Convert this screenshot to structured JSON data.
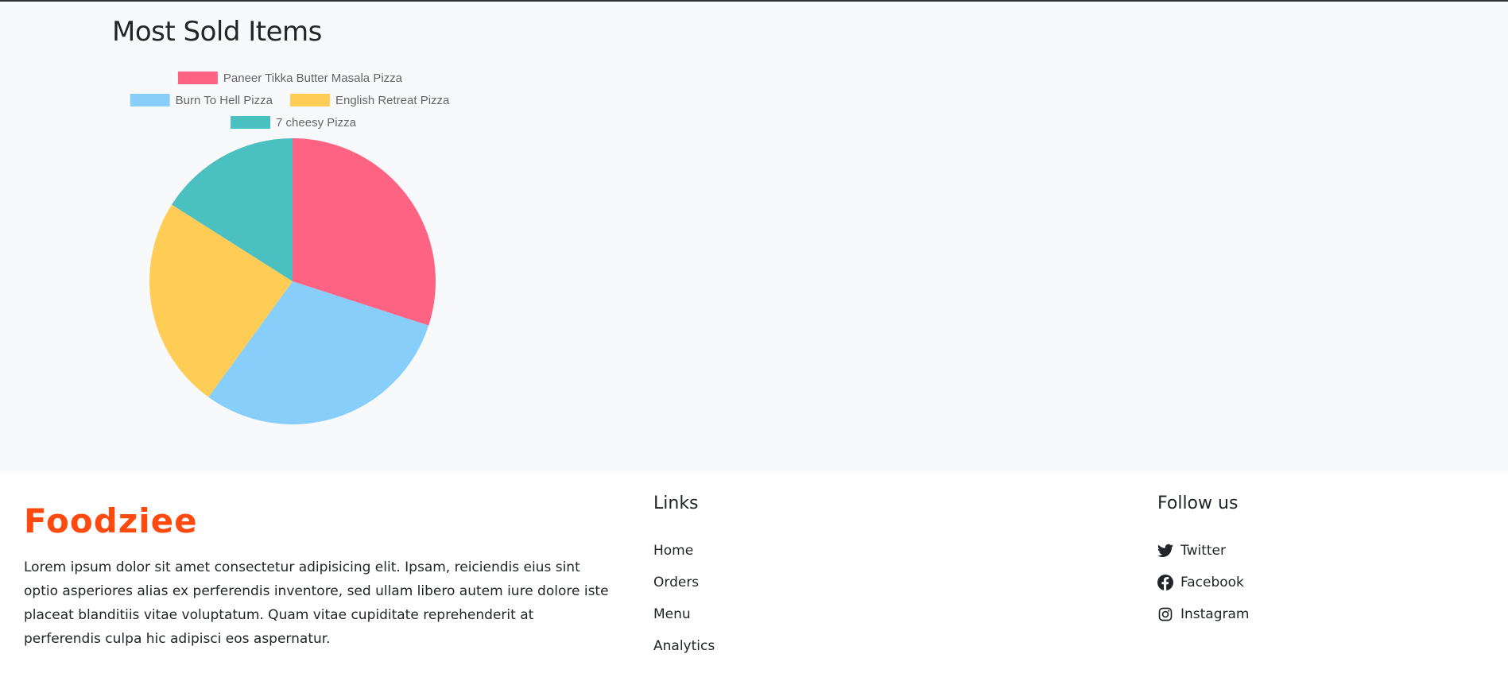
{
  "section": {
    "title": "Most Sold Items"
  },
  "chart_data": {
    "type": "pie",
    "title": "",
    "labels": [
      "Paneer Tikka Butter Masala Pizza",
      "Burn To Hell Pizza",
      "English Retreat Pizza",
      "7 cheesy Pizza"
    ],
    "values": [
      30,
      30,
      24,
      16
    ],
    "colors": [
      "#ff6384",
      "#87cefa",
      "#ffcd56",
      "#4bc0c0"
    ],
    "legend_position": "top"
  },
  "footer": {
    "brand": "Foodziee",
    "about": "Lorem ipsum dolor sit amet consectetur adipisicing elit. Ipsam, reiciendis eius sint optio asperiores alias ex perferendis inventore, sed ullam libero autem iure dolore iste placeat blanditiis vitae voluptatum. Quam vitae cupiditate reprehenderit at perferendis culpa hic adipisci eos aspernatur.",
    "links_heading": "Links",
    "links": [
      "Home",
      "Orders",
      "Menu",
      "Analytics"
    ],
    "follow_heading": "Follow us",
    "social": [
      {
        "label": "Twitter",
        "icon": "twitter-icon"
      },
      {
        "label": "Facebook",
        "icon": "facebook-icon"
      },
      {
        "label": "Instagram",
        "icon": "instagram-icon"
      }
    ],
    "brand_color": "#ff4a0f"
  }
}
